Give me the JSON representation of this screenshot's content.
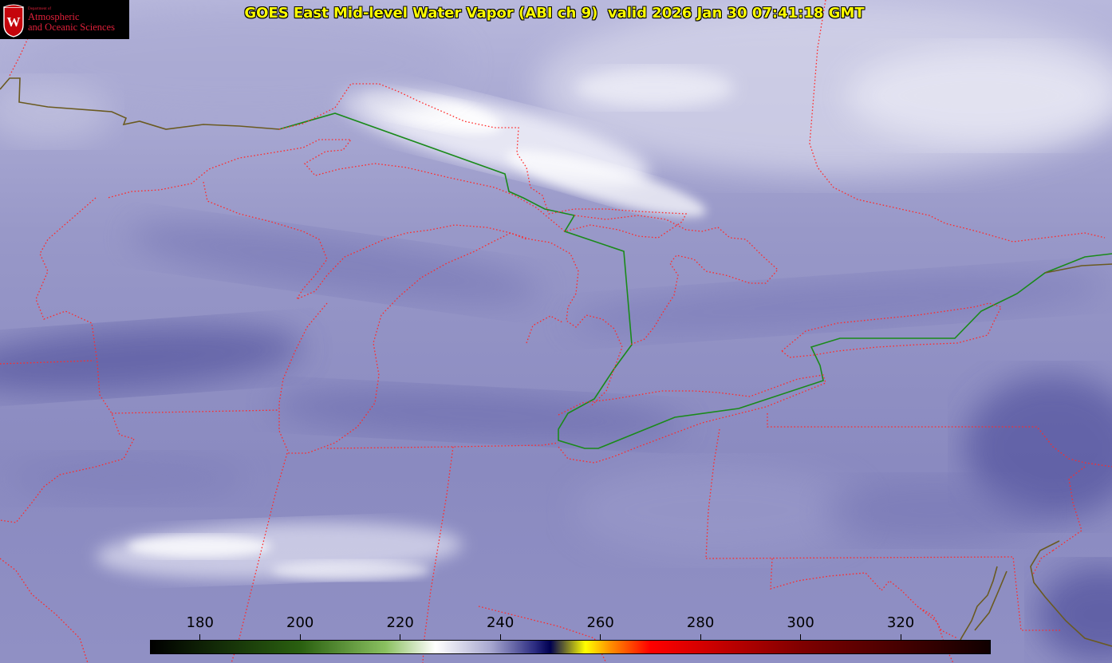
{
  "title": "GOES East Mid-level Water Vapor (ABI ch 9)  valid 2026 Jan 30 07:41:18 GMT",
  "logo": {
    "dept": "Department of",
    "line1": "Atmospheric",
    "line2": "and Oceanic Sciences",
    "seal_letter": "W"
  },
  "colorbar": {
    "min": 170,
    "max": 338,
    "ticks": [
      "180",
      "200",
      "220",
      "240",
      "260",
      "280",
      "300",
      "320"
    ],
    "stops": [
      {
        "value": 170,
        "color": "#000000"
      },
      {
        "value": 200,
        "color": "#2a6010"
      },
      {
        "value": 217,
        "color": "#8ac060"
      },
      {
        "value": 227,
        "color": "#ffffff"
      },
      {
        "value": 238,
        "color": "#a8a8d0"
      },
      {
        "value": 247,
        "color": "#2a2a80"
      },
      {
        "value": 250,
        "color": "#000050"
      },
      {
        "value": 257,
        "color": "#ffff00"
      },
      {
        "value": 262,
        "color": "#ff9000"
      },
      {
        "value": 270,
        "color": "#ff0000"
      },
      {
        "value": 300,
        "color": "#800000"
      },
      {
        "value": 338,
        "color": "#100000"
      }
    ]
  },
  "colors": {
    "state_borders": "#ff2a2a",
    "us_canada_border": "#1a8a1a",
    "coast_olive": "#6a5a20",
    "background_vapor": "#8c8cc2"
  }
}
